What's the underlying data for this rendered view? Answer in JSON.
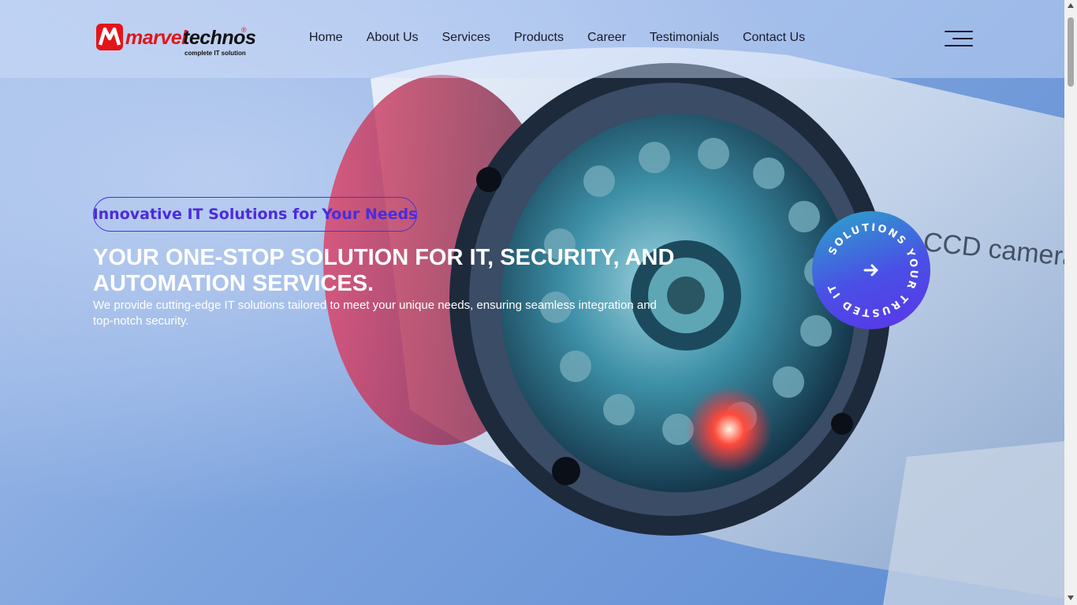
{
  "brand": {
    "name_part1": "marvel",
    "name_part2": "technos",
    "registered_mark": "®",
    "tagline": "complete IT solution",
    "logo_color": "#e3151a"
  },
  "nav": {
    "items": [
      {
        "label": "Home"
      },
      {
        "label": "About Us"
      },
      {
        "label": "Services"
      },
      {
        "label": "Products"
      },
      {
        "label": "Career"
      },
      {
        "label": "Testimonials"
      },
      {
        "label": "Contact Us"
      }
    ],
    "menu_icon": "hamburger-menu-icon"
  },
  "hero": {
    "pill_text": "Innovative IT Solutions for Your Needs",
    "headline": "YOUR ONE-STOP SOLUTION FOR IT, SECURITY, AND AUTOMATION SERVICES.",
    "subtext": "We provide cutting-edge IT solutions tailored to meet your unique needs, ensuring seamless integration and top-notch security.",
    "accent_color": "#4d2bdc"
  },
  "badge": {
    "ring_text": "SOLUTIONS YOUR TRUSTED IT",
    "icon": "arrow-right-icon"
  },
  "background": {
    "camera_label": "CCD camera"
  }
}
